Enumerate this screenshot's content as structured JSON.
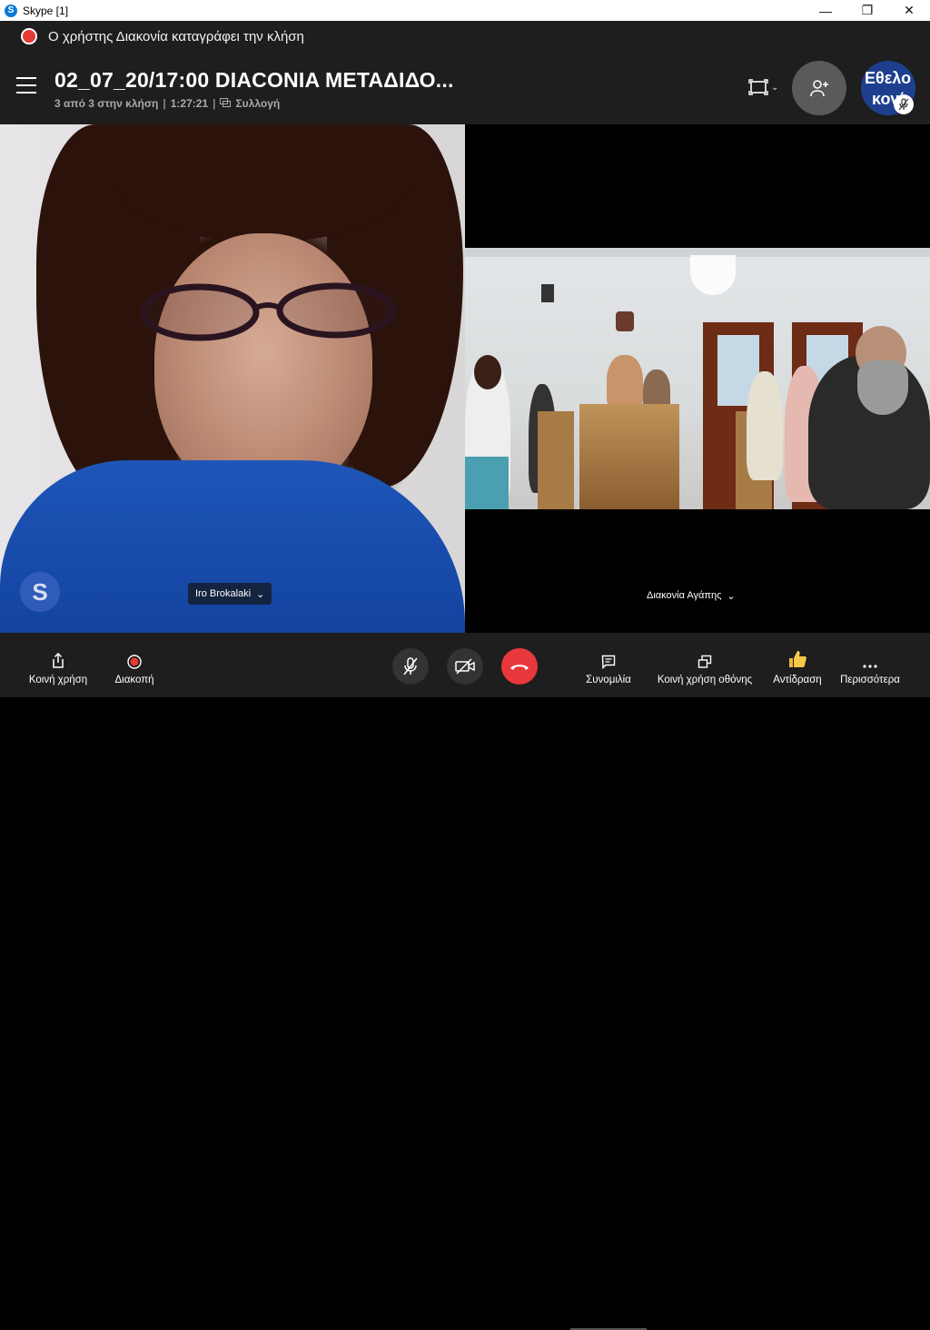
{
  "window": {
    "app_title": "Skype [1]"
  },
  "recording_banner": {
    "text": "Ο χρήστης Διακονία καταγράφει την κλήση"
  },
  "call": {
    "title": "02_07_20/17:00 DIACONIA ΜΕΤΑΔΙΔΟ...",
    "participants": "3 από 3 στην κλήση",
    "duration": "1:27:21",
    "gallery_label": "Συλλογή"
  },
  "group_avatar": {
    "line1": "Εθελο",
    "line2": "κονί"
  },
  "videos": {
    "left_name": "Iro Brokalaki",
    "right_name": "Διακονία Αγάπης"
  },
  "watermark": {
    "letter": "S"
  },
  "toolbar": {
    "share_label": "Κοινή χρήση",
    "stop_label": "Διακοπή",
    "chat_label": "Συνομιλία",
    "screen_share_label": "Κοινή χρήση οθόνης",
    "react_label": "Αντίδραση",
    "more_label": "Περισσότερα"
  },
  "colors": {
    "record_red": "#e53935",
    "hangup_red": "#e8383c",
    "header_bg": "#1e1e1e"
  }
}
